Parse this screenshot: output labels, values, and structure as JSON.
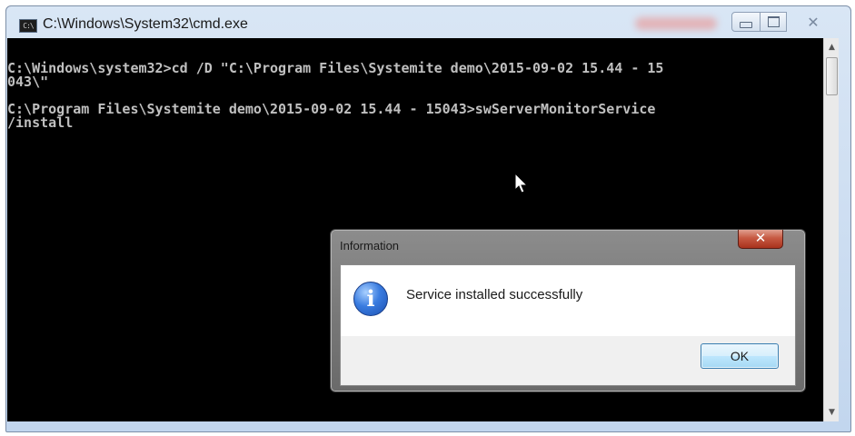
{
  "window": {
    "title": "C:\\Windows\\System32\\cmd.exe",
    "icon": "cmd-icon",
    "icon_glyph": "C:\\",
    "controls": {
      "minimize": "minimize-icon",
      "maximize": "maximize-icon",
      "close_glyph": "✕"
    }
  },
  "console": {
    "lines": [
      "C:\\Windows\\system32>cd /D \"C:\\Program Files\\Systemite demo\\2015-09-02 15.44 - 15",
      "043\\\"",
      "",
      "C:\\Program Files\\Systemite demo\\2015-09-02 15.44 - 15043>swServerMonitorService",
      "/install"
    ]
  },
  "scrollbar": {
    "up_glyph": "▲",
    "down_glyph": "▼"
  },
  "dialog": {
    "title": "Information",
    "close_glyph": "✕",
    "icon": "info-icon",
    "icon_glyph": "i",
    "message": "Service installed successfully",
    "ok_label": "OK"
  },
  "colors": {
    "console_bg": "#000000",
    "console_text": "#c0c0c0",
    "close_button": "#c75a43",
    "ok_border": "#3c7fb1"
  }
}
